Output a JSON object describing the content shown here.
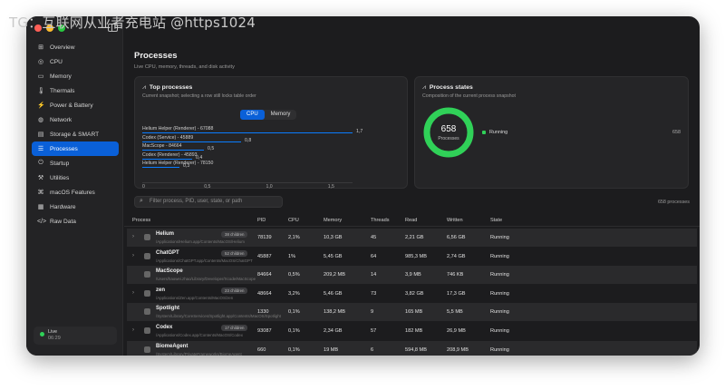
{
  "watermark": "TG：互联网从业者充电站 @https1024",
  "sidebar": {
    "items": [
      {
        "label": "Overview",
        "icon": "grid-icon",
        "glyph": "⊞"
      },
      {
        "label": "CPU",
        "icon": "cpu-icon",
        "glyph": "◎"
      },
      {
        "label": "Memory",
        "icon": "memory-icon",
        "glyph": "▭"
      },
      {
        "label": "Thermals",
        "icon": "thermometer-icon",
        "glyph": "🌡"
      },
      {
        "label": "Power & Battery",
        "icon": "bolt-icon",
        "glyph": "⚡"
      },
      {
        "label": "Network",
        "icon": "globe-icon",
        "glyph": "◍"
      },
      {
        "label": "Storage & SMART",
        "icon": "drive-icon",
        "glyph": "▤"
      },
      {
        "label": "Processes",
        "icon": "list-icon",
        "glyph": "☰"
      },
      {
        "label": "Startup",
        "icon": "power-icon",
        "glyph": "⏻"
      },
      {
        "label": "Utilities",
        "icon": "tools-icon",
        "glyph": "⚒"
      },
      {
        "label": "macOS Features",
        "icon": "apple-icon",
        "glyph": "⌘"
      },
      {
        "label": "Hardware",
        "icon": "hardware-icon",
        "glyph": "▦"
      },
      {
        "label": "Raw Data",
        "icon": "code-icon",
        "glyph": "</>"
      }
    ],
    "active_index": 7,
    "live_label": "Live",
    "live_time": "06:29"
  },
  "main": {
    "title": "Processes",
    "subtitle": "Live CPU, memory, threads, and disk activity",
    "top_card": {
      "title": "Top processes",
      "subtitle": "Current snapshot; selecting a row still locks table order",
      "seg_cpu": "CPU",
      "seg_memory": "Memory",
      "bars": [
        {
          "label": "Helium Helper (Renderer) - 67088",
          "value": 1.7,
          "value_text": "1,7"
        },
        {
          "label": "Codex (Service) - 45889",
          "value": 0.8,
          "value_text": "0,8"
        },
        {
          "label": "MacScope - 84664",
          "value": 0.5,
          "value_text": "0,5"
        },
        {
          "label": "Codex (Renderer) - 45893",
          "value": 0.4,
          "value_text": "0,4"
        },
        {
          "label": "Helium Helper (Renderer) - 78150",
          "value": 0.3,
          "value_text": "0,3"
        }
      ],
      "axis": [
        "0",
        "0,5",
        "1,0",
        "1,5"
      ]
    },
    "states_card": {
      "title": "Process states",
      "subtitle": "Composition of the current process snapshot",
      "total": "658",
      "total_label": "Processes",
      "legend_label": "Running",
      "legend_value": "658",
      "color": "#30d158"
    },
    "search_placeholder": "Filter process, PID, user, state, or path",
    "count_text": "658 processes",
    "columns": [
      "Process",
      "PID",
      "CPU",
      "Memory",
      "Threads",
      "Read",
      "Written",
      "State"
    ],
    "rows": [
      {
        "name": "Helium",
        "path": "/Applications/Helium.app/Contents/MacOS/Helium",
        "badge": "38 children",
        "pid": "78139",
        "cpu": "2,1%",
        "memory": "10,3 GB",
        "threads": "45",
        "read": "2,21 GB",
        "written": "6,56 GB",
        "state": "Running",
        "expand": true
      },
      {
        "name": "ChatGPT",
        "path": "/Applications/ChatGPT.app/Contents/MacOS/ChatGPT",
        "badge": "52 children",
        "pid": "45887",
        "cpu": "1%",
        "memory": "5,45 GB",
        "threads": "64",
        "read": "985,3 MB",
        "written": "2,74 GB",
        "state": "Running",
        "expand": true
      },
      {
        "name": "MacScope",
        "path": "/Users/haowei.zhao/Library/Developer/Xcode/MacScope",
        "badge": "",
        "pid": "84664",
        "cpu": "0,5%",
        "memory": "209,2 MB",
        "threads": "14",
        "read": "3,9 MB",
        "written": "746 KB",
        "state": "Running",
        "expand": false
      },
      {
        "name": "zen",
        "path": "/Applications/Zen.app/Contents/MacOS/zen",
        "badge": "23 children",
        "pid": "48664",
        "cpu": "3,2%",
        "memory": "5,46 GB",
        "threads": "73",
        "read": "3,82 GB",
        "written": "17,3 GB",
        "state": "Running",
        "expand": true
      },
      {
        "name": "Spotlight",
        "path": "/System/Library/CoreServices/Spotlight.app/Contents/MacOS/Spotlight",
        "badge": "",
        "pid": "1330",
        "cpu": "0,1%",
        "memory": "138,2 MB",
        "threads": "9",
        "read": "165 MB",
        "written": "5,5 MB",
        "state": "Running",
        "expand": false
      },
      {
        "name": "Codex",
        "path": "/Applications/Codex.app/Contents/MacOS/Codex",
        "badge": "17 children",
        "pid": "93087",
        "cpu": "0,1%",
        "memory": "2,34 GB",
        "threads": "57",
        "read": "182 MB",
        "written": "26,9 MB",
        "state": "Running",
        "expand": true
      },
      {
        "name": "BiomeAgent",
        "path": "/System/Library/PrivateFrameworks/BiomeAgent",
        "badge": "",
        "pid": "660",
        "cpu": "0,1%",
        "memory": "19 MB",
        "threads": "6",
        "read": "594,8 MB",
        "written": "208,9 MB",
        "state": "Running",
        "expand": false
      }
    ]
  }
}
